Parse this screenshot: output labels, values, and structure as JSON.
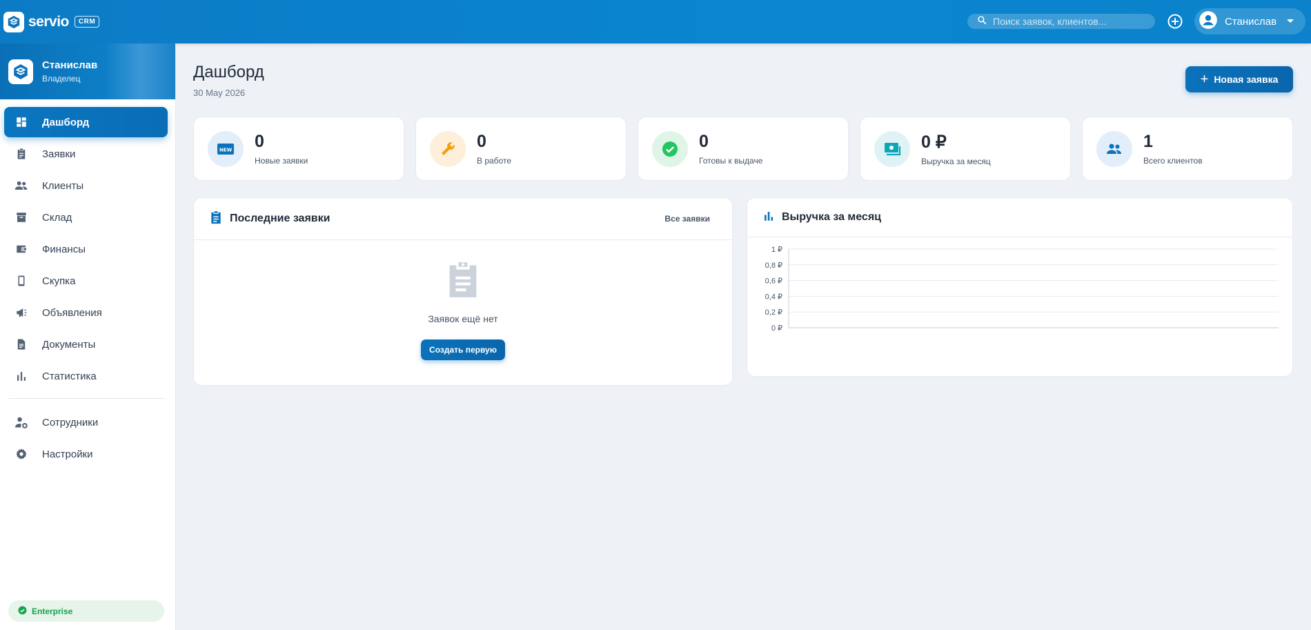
{
  "app": {
    "logo_text": "servio",
    "logo_badge": "CRM"
  },
  "topbar": {
    "search_placeholder": "Поиск заявок, клиентов...",
    "user_name": "Станислав"
  },
  "sidebar": {
    "profile_name": "Станислав",
    "profile_role": "Владелец",
    "items": [
      {
        "label": "Дашборд",
        "icon": "dashboard-icon",
        "active": true
      },
      {
        "label": "Заявки",
        "icon": "clipboard-icon"
      },
      {
        "label": "Клиенты",
        "icon": "people-icon"
      },
      {
        "label": "Склад",
        "icon": "archive-icon"
      },
      {
        "label": "Финансы",
        "icon": "wallet-icon"
      },
      {
        "label": "Скупка",
        "icon": "phone-icon"
      },
      {
        "label": "Объявления",
        "icon": "megaphone-icon"
      },
      {
        "label": "Документы",
        "icon": "document-icon"
      },
      {
        "label": "Статистика",
        "icon": "bar-chart-icon"
      }
    ],
    "secondary_items": [
      {
        "label": "Сотрудники",
        "icon": "user-gear-icon"
      },
      {
        "label": "Настройки",
        "icon": "gear-icon"
      }
    ],
    "plan": "Enterprise"
  },
  "page": {
    "title": "Дашборд",
    "date": "30 May 2026",
    "new_button": "Новая заявка"
  },
  "stats": [
    {
      "value": "0",
      "label": "Новые заявки",
      "icon": "new-badge-icon",
      "color": "#0b72bb"
    },
    {
      "value": "0",
      "label": "В работе",
      "icon": "wrench-icon",
      "color": "#f59e0b"
    },
    {
      "value": "0",
      "label": "Готовы к выдаче",
      "icon": "check-circle-icon",
      "color": "#22c55e"
    },
    {
      "value": "0 ₽",
      "label": "Выручка за месяц",
      "icon": "cash-icon",
      "color": "#0ea5b7"
    },
    {
      "value": "1",
      "label": "Всего клиентов",
      "icon": "people-icon",
      "color": "#0b72bb"
    }
  ],
  "recent": {
    "title": "Последние заявки",
    "all_link": "Все заявки",
    "empty_text": "Заявок ещё нет",
    "create_button": "Создать первую"
  },
  "revenue": {
    "title": "Выручка за месяц"
  },
  "chart_data": {
    "type": "line",
    "title": "Выручка за месяц",
    "y_ticks": [
      "0 ₽",
      "0,2 ₽",
      "0,4 ₽",
      "0,6 ₽",
      "0,8 ₽",
      "1 ₽"
    ],
    "ylim": [
      0,
      1
    ],
    "series": [],
    "grid": true
  }
}
